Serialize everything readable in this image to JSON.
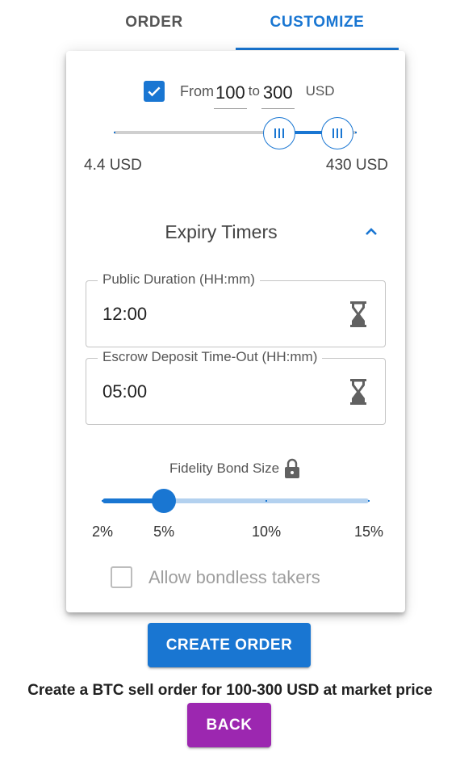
{
  "tabs": [
    {
      "label": "ORDER",
      "active": false
    },
    {
      "label": "CUSTOMIZE",
      "active": true
    }
  ],
  "range": {
    "enabled": true,
    "from_label": "From",
    "min": "100",
    "to_label": "to",
    "max": "300",
    "currency": "USD",
    "slider_min_label": "4.4 USD",
    "slider_max_label": "430 USD",
    "slider_min_value": 4.4,
    "slider_max_value": 430
  },
  "expiry": {
    "title": "Expiry Timers",
    "expanded": true,
    "fields": [
      {
        "label": "Public Duration (HH:mm)",
        "value": "12:00",
        "icon": "hourglass-icon"
      },
      {
        "label": "Escrow Deposit Time-Out (HH:mm)",
        "value": "05:00",
        "icon": "hourglass-icon"
      }
    ]
  },
  "bond": {
    "label": "Fidelity Bond Size",
    "locked": true,
    "value": 5,
    "min": 2,
    "max": 15,
    "marks": [
      "2%",
      "5%",
      "10%",
      "15%"
    ],
    "mark_values": [
      2,
      5,
      10,
      15
    ]
  },
  "bondless": {
    "label": "Allow bondless takers",
    "checked": false
  },
  "create_button": "CREATE ORDER",
  "summary": "Create a BTC sell order for 100-300 USD at market price",
  "back_button": "BACK",
  "colors": {
    "primary": "#1976d2",
    "secondary": "#9c27b0"
  }
}
